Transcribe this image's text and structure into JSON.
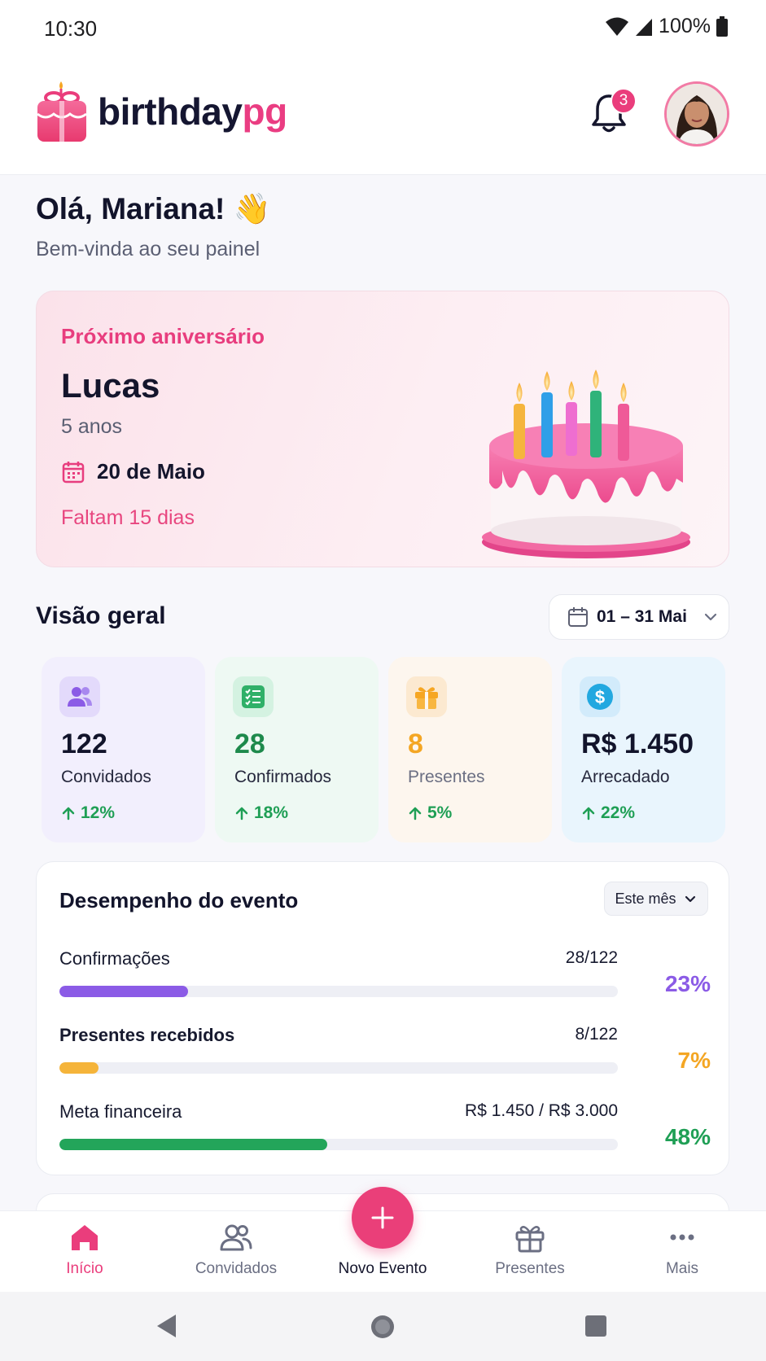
{
  "status_bar": {
    "time": "10:30",
    "battery": "100%"
  },
  "header": {
    "logo_dark": "birthday",
    "logo_pink": "pg",
    "notification_count": "3"
  },
  "greeting": {
    "title": "Olá, Mariana! 👋",
    "subtitle": "Bem-vinda ao seu painel"
  },
  "next_birthday": {
    "label": "Próximo aniversário",
    "name": "Lucas",
    "age": "5 anos",
    "date": "20 de Maio",
    "countdown": "Faltam 15 dias"
  },
  "overview": {
    "title": "Visão geral",
    "date_range": "01 – 31 Mai",
    "stats": [
      {
        "value": "122",
        "label": "Convidados",
        "change": "12%",
        "icon": "users-icon",
        "color": "#7c4fe0"
      },
      {
        "value": "28",
        "label": "Confirmados",
        "change": "18%",
        "icon": "checklist-icon",
        "color": "#1e8a4c"
      },
      {
        "value": "8",
        "label": "Presentes",
        "change": "5%",
        "icon": "gift-icon",
        "color": "#f4a623"
      },
      {
        "value": "R$ 1.450",
        "label": "Arrecadado",
        "change": "22%",
        "icon": "dollar-icon",
        "color": "#12142b"
      }
    ]
  },
  "performance": {
    "title": "Desempenho do evento",
    "filter": "Este mês",
    "metrics": [
      {
        "label": "Confirmações",
        "value": "28/122",
        "percent": "23%",
        "progress": 0.23,
        "color": "#8b5be6"
      },
      {
        "label": "Presentes recebidos",
        "value": "8/122",
        "percent": "7%",
        "progress": 0.07,
        "color": "#f5b43a"
      },
      {
        "label": "Meta financeira",
        "value": "R$ 1.450 / R$ 3.000",
        "percent": "48%",
        "progress": 0.48,
        "color": "#23a55a"
      }
    ]
  },
  "bottom_nav": {
    "items": [
      {
        "label": "Início",
        "icon": "home-icon"
      },
      {
        "label": "Convidados",
        "icon": "users-icon"
      },
      {
        "label": "Novo Evento",
        "icon": "plus-icon"
      },
      {
        "label": "Presentes",
        "icon": "gift-icon"
      },
      {
        "label": "Mais",
        "icon": "more-icon"
      }
    ]
  },
  "colors": {
    "accent": "#ea3d7c",
    "success": "#1f9f55"
  }
}
